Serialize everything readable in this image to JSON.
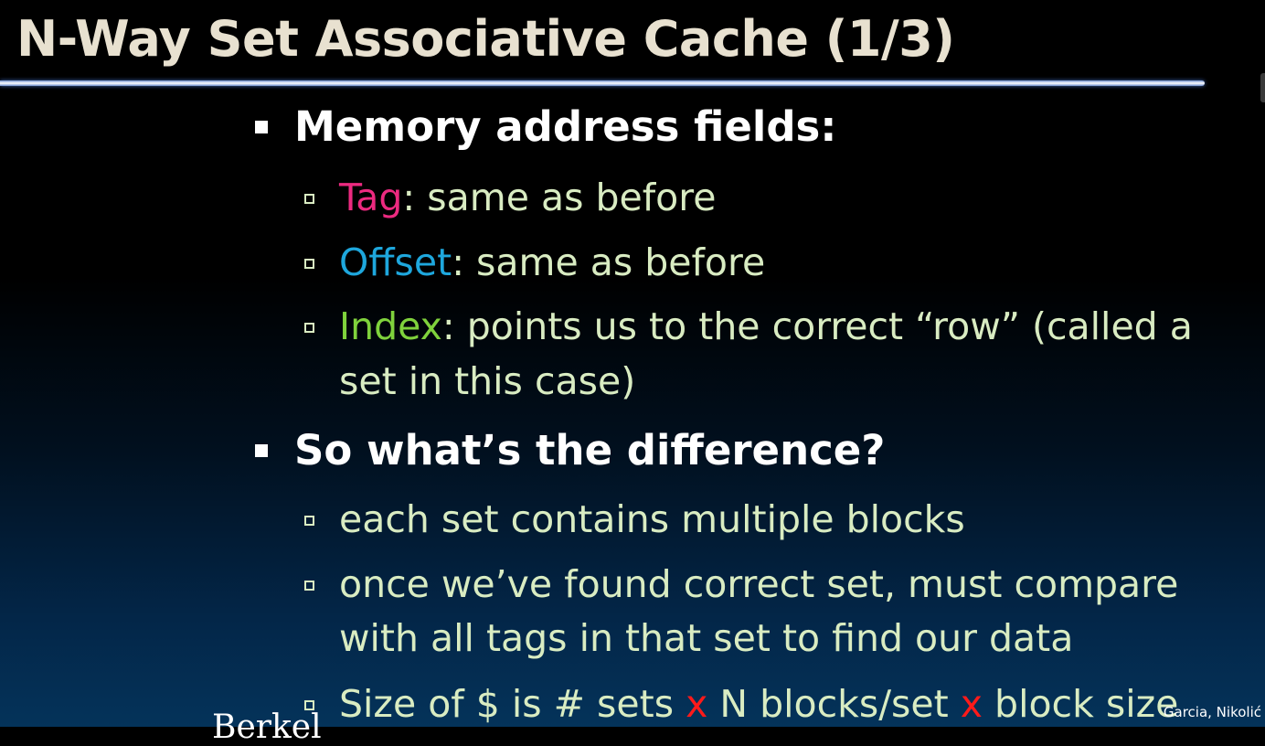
{
  "title": "N-Way Set Associative Cache (1/3)",
  "bullets": {
    "fields_heading": "Memory address fields:",
    "tag_term": "Tag",
    "tag_text": ": same as before",
    "offset_term": "Offset",
    "offset_text": ": same as before",
    "index_term": "Index",
    "index_text_1": ": points us to the correct “row” (called a",
    "index_text_2": "set in this case)",
    "difference_heading": "So what’s the difference?",
    "diff_1": "each set contains multiple blocks",
    "diff_2_line1": "once we’ve found correct set, must compare",
    "diff_2_line2": "with all tags in that set to find our data",
    "size_part1": "Size of $ is # sets ",
    "size_x1": "x",
    "size_part2": " N blocks/set ",
    "size_x2": "x",
    "size_part3": " block size"
  },
  "footer": {
    "left_fragment": "Berkel",
    "authors": "Garcia, Nikolić"
  },
  "colors": {
    "title": "#e8e1d0",
    "heading": "#ffffff",
    "body": "#d9ecc2",
    "tag": "#ec2a80",
    "offset": "#1ea7dd",
    "index": "#7fd23c",
    "x_mark": "#ff1a1a"
  }
}
